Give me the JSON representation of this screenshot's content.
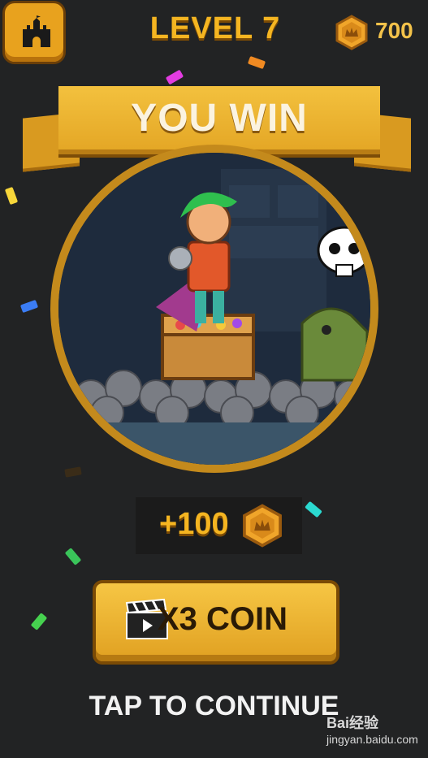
{
  "header": {
    "level_label": "LEVEL 7",
    "coin_balance": "700"
  },
  "banner": {
    "title": "YOU WIN"
  },
  "reward": {
    "amount_label": "+100"
  },
  "actions": {
    "x3_label": "X3 COIN",
    "continue_label": "TAP TO CONTINUE"
  },
  "watermark": {
    "brand": "Bai经验",
    "url": "jingyan.baidu.com"
  },
  "colors": {
    "gold": "#f5b521",
    "background": "#222324",
    "button": "#e8a21e"
  },
  "icons": [
    "castle-icon",
    "coin-icon",
    "clapperboard-icon",
    "skull-icon"
  ]
}
